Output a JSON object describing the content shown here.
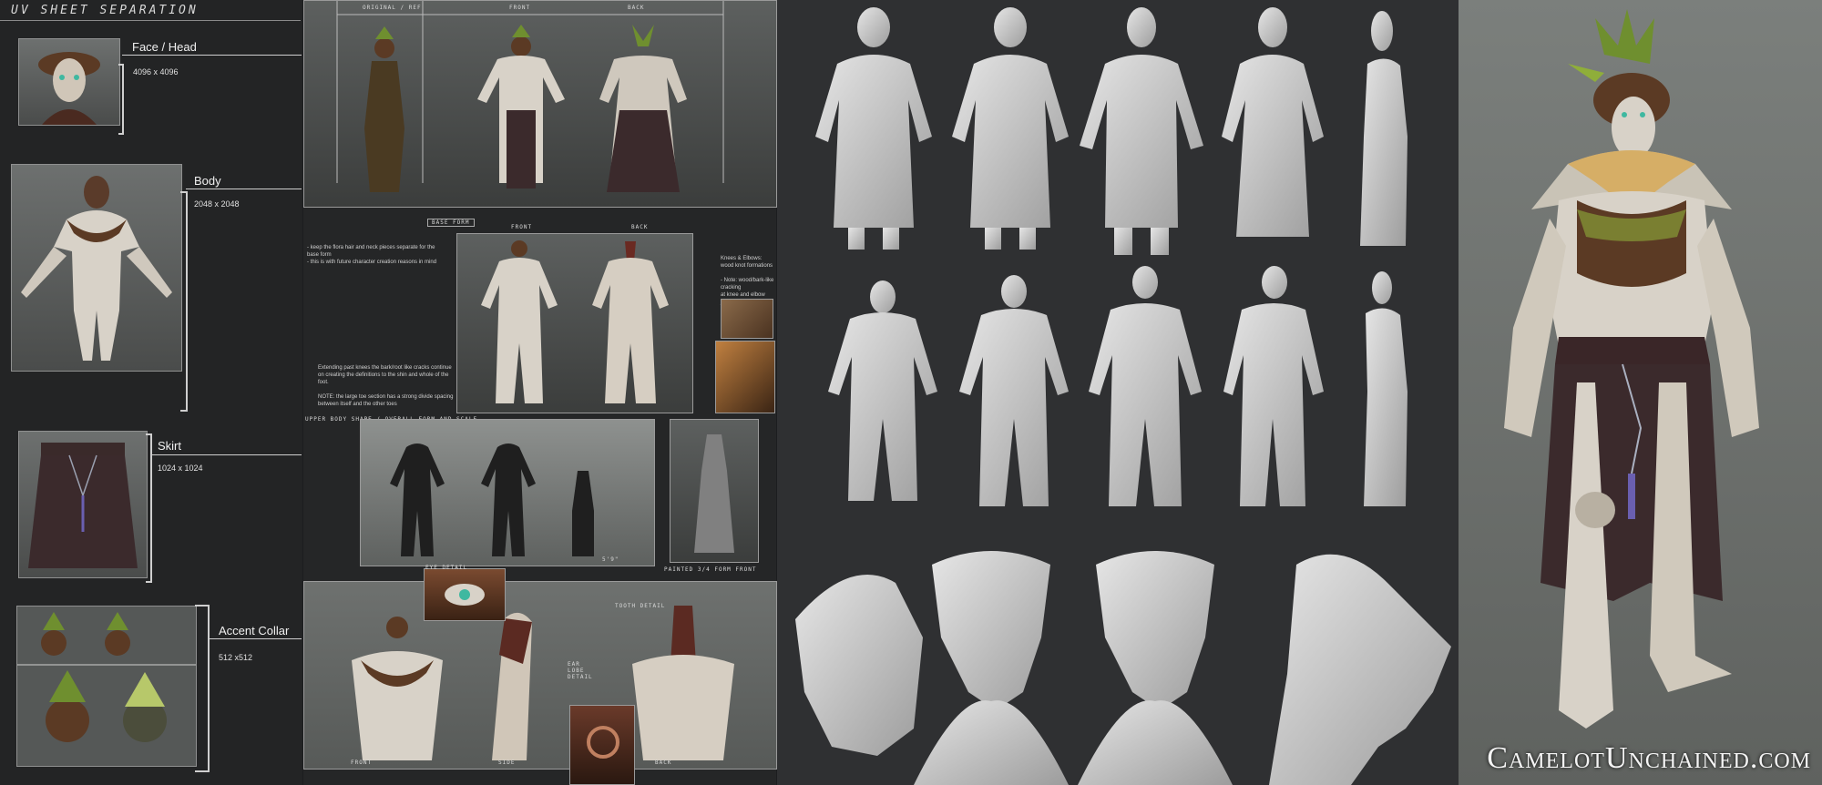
{
  "uv_sheet": {
    "title": "UV   SHEET   SEPARATION",
    "sections": [
      {
        "label": "Face / Head",
        "size": "4096 x 4096"
      },
      {
        "label": "Body",
        "size": "2048 x 2048"
      },
      {
        "label": "Skirt",
        "size": "1024 x 1024"
      },
      {
        "label": "Accent Collar",
        "size": "512 x512"
      }
    ]
  },
  "concept": {
    "top_labels": [
      "ORIGINAL / REF",
      "FRONT",
      "BACK"
    ],
    "base_form_label": "BASE FORM",
    "base_form_sub": [
      "FRONT",
      "BACK"
    ],
    "note_left_1": "- keep the flora hair and neck pieces separate for the base form\n  - this is with future character creation reasons in mind",
    "note_left_2": "Extending past knees the bark/root like cracks continue on creating the definitions to the shin and whole of the foot.\n\n      NOTE: the large toe section has a strong divide spacing between itself and the other toes",
    "note_right": "Knees & Elbows:\n  wood knot formations\n\n- Note: wood/bark-like cracking\n  at knee and elbow joint areas",
    "silhouette_label": "UPPER BODY SHAPE / OVERALL FORM AND SCALE",
    "silhouette_note": "5'9\"",
    "paint_label": "PAINTED 3/4 FORM FRONT",
    "eye_label": "EYE DETAIL",
    "mouth_label": "TOOTH DETAIL",
    "ear_label": "EAR LOBE DETAIL",
    "bust_labels": [
      "FRONT",
      "SIDE",
      "BACK"
    ]
  },
  "branding": {
    "watermark": "CamelotUnchained.com"
  },
  "colors": {
    "background": "#1c1d1f",
    "sculpt_bg": "#2f3032",
    "render_bg": "#6f736f",
    "skin": "#d8d2c8",
    "bark": "#5b3a24",
    "leaf": "#6f8f2f",
    "skirt": "#3b2a2c"
  }
}
